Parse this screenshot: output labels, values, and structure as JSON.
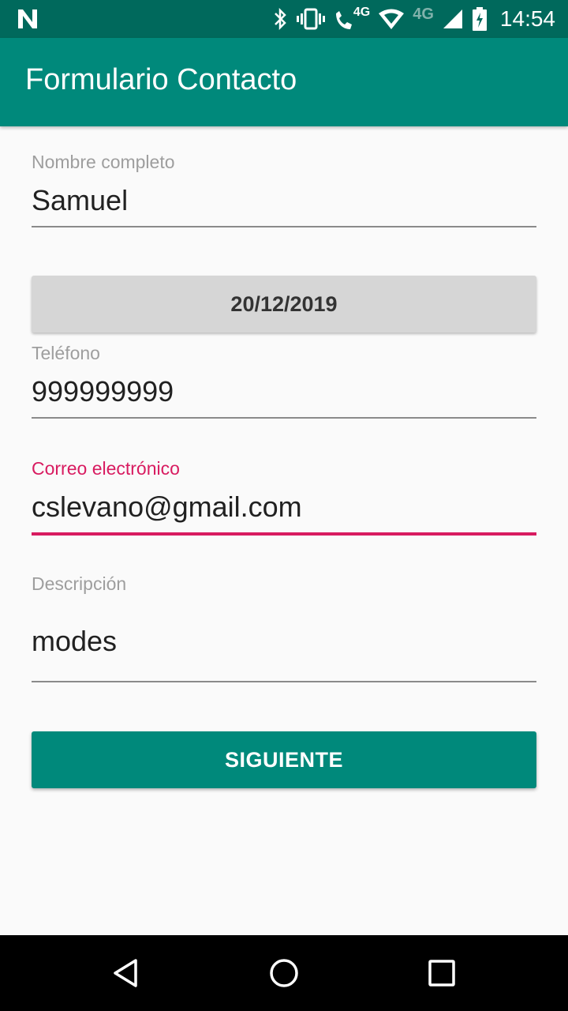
{
  "status_bar": {
    "time": "14:54",
    "network_small": "4G",
    "network_large": "4G",
    "icons": [
      "n-logo-icon",
      "bluetooth-icon",
      "vibrate-icon",
      "wifi-calling-icon",
      "wifi-icon",
      "signal-icon",
      "battery-charging-icon"
    ]
  },
  "app_bar": {
    "title": "Formulario Contacto"
  },
  "form": {
    "name": {
      "label": "Nombre completo",
      "value": "Samuel"
    },
    "date_button": {
      "label": "20/12/2019"
    },
    "phone": {
      "label": "Teléfono",
      "value": "999999999"
    },
    "email": {
      "label": "Correo electrónico",
      "value": "cslevano@gmail.com"
    },
    "description": {
      "label": "Descripción",
      "value": "modes"
    },
    "next_button": {
      "label": "SIGUIENTE"
    }
  },
  "nav_bar": {
    "icons": [
      "back-icon",
      "home-icon",
      "recents-icon"
    ]
  },
  "colors": {
    "primary": "#00897b",
    "primary_dark": "#00695c",
    "accent": "#d81b60",
    "background": "#fafafa"
  }
}
